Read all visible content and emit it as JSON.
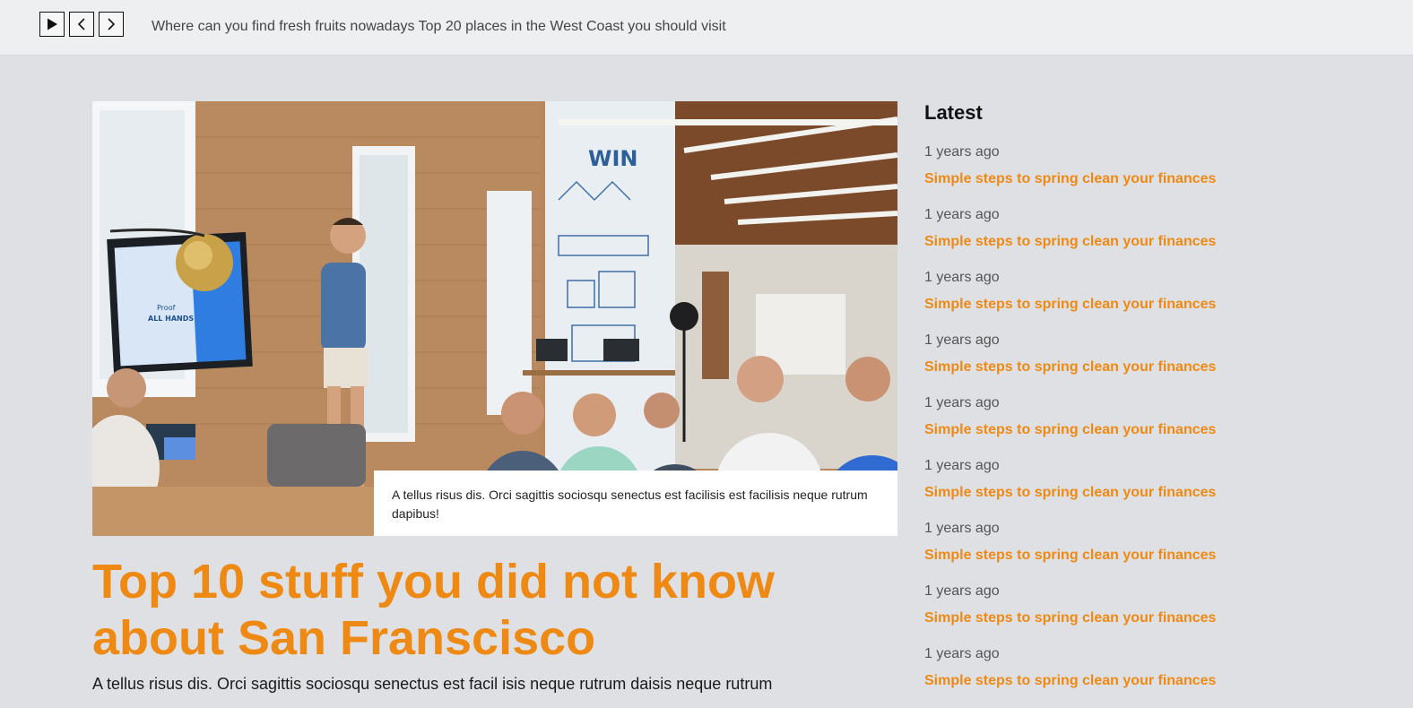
{
  "ticker": {
    "controls": [
      {
        "name": "play-icon"
      },
      {
        "name": "chevron-left-icon"
      },
      {
        "name": "chevron-right-icon"
      }
    ],
    "text": "Where can you find fresh fruits nowadays Top 20 places in the West Coast you should visit"
  },
  "feature": {
    "image_caption": "A tellus risus dis. Orci sagittis sociosqu senectus est facilisis est facilisis neque rutrum dapibus!",
    "headline": "Top 10 stuff you did not know about San Franscisco",
    "lede": "A tellus risus dis. Orci sagittis sociosqu senectus est facil isis neque rutrum daisis neque rutrum"
  },
  "sidebar": {
    "title": "Latest",
    "items": [
      {
        "time": "1 years ago",
        "title": "Simple steps to spring clean your finances"
      },
      {
        "time": "1 years ago",
        "title": "Simple steps to spring clean your finances"
      },
      {
        "time": "1 years ago",
        "title": "Simple steps to spring clean your finances"
      },
      {
        "time": "1 years ago",
        "title": "Simple steps to spring clean your finances"
      },
      {
        "time": "1 years ago",
        "title": "Simple steps to spring clean your finances"
      },
      {
        "time": "1 years ago",
        "title": "Simple steps to spring clean your finances"
      },
      {
        "time": "1 years ago",
        "title": "Simple steps to spring clean your finances"
      },
      {
        "time": "1 years ago",
        "title": "Simple steps to spring clean your finances"
      },
      {
        "time": "1 years ago",
        "title": "Simple steps to spring clean your finances"
      }
    ]
  },
  "colors": {
    "accent": "#ee8a14",
    "page_background": "#dee0e4",
    "topbar_background": "#eeeff1"
  }
}
